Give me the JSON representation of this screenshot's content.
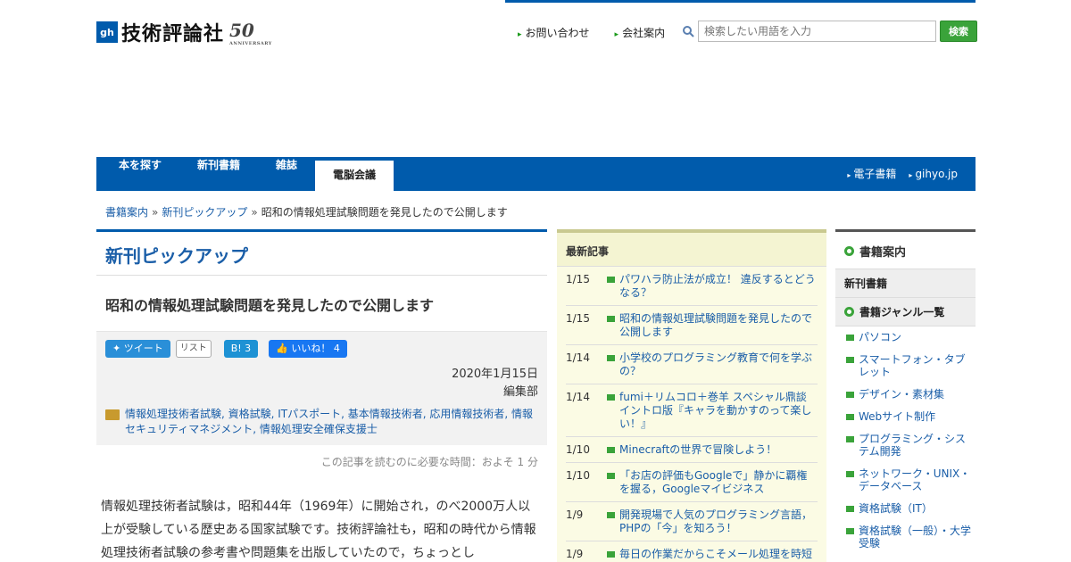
{
  "header": {
    "logo_mark": "gh",
    "logo_text": "技術評論社",
    "logo_anniv": "50",
    "logo_anniv_sub": "ANNIVERSARY",
    "links": [
      "お問い合わせ",
      "会社案内"
    ],
    "search_placeholder": "検索したい用語を入力",
    "search_button": "検索"
  },
  "nav": {
    "items": [
      "本を探す",
      "新刊書籍",
      "雑誌",
      "電脳会議"
    ],
    "right": [
      "電子書籍",
      "gihyo.jp"
    ]
  },
  "breadcrumb": [
    "書籍案内",
    "新刊ピックアップ",
    "昭和の情報処理試験問題を発見したので公開します"
  ],
  "main": {
    "section_title": "新刊ピックアップ",
    "article_title": "昭和の情報処理試験問題を発見したので公開します",
    "social": {
      "tweet": "ツイート",
      "list": "リスト",
      "hatena": "B! 3",
      "like": "いいね！ 4"
    },
    "date": "2020年1月15日",
    "author": "編集部",
    "tags": "情報処理技術者試験, 資格試験, ITパスポート, 基本情報技術者, 応用情報技術者, 情報セキュリティマネジメント, 情報処理安全確保支援士",
    "read_time": "この記事を読むのに必要な時間：およそ 1 分",
    "body": "情報処理技術者試験は，昭和44年（1969年）に開始され，のべ2000万人以上が受験している歴史ある国家試験です。技術評論社も，昭和の時代から情報処理技術者試験の参考書や問題集を出版していたので，ちょっとし"
  },
  "latest": {
    "heading": "最新記事",
    "items": [
      {
        "date": "1/15",
        "title": "パワハラ防止法が成立！ 違反するとどうなる？"
      },
      {
        "date": "1/15",
        "title": "昭和の情報処理試験問題を発見したので公開します"
      },
      {
        "date": "1/14",
        "title": "小学校のプログラミング教育で何を学ぶの？"
      },
      {
        "date": "1/14",
        "title": "fumi＋リムコロ＋巻羊 スペシャル鼎談 イントロ版『キャラを動かすのって楽しい！』"
      },
      {
        "date": "1/10",
        "title": "Minecraftの世界で冒険しよう！"
      },
      {
        "date": "1/10",
        "title": "「お店の評価もGoogleで」静かに覇権を握る，Googleマイビジネス"
      },
      {
        "date": "1/9",
        "title": "開発現場で人気のプログラミング言語，PHPの「今」を知ろう！"
      },
      {
        "date": "1/9",
        "title": "毎日の作業だからこそメール処理を時短"
      }
    ]
  },
  "side": {
    "heading": "書籍案内",
    "sub1": "新刊書籍",
    "sub2": "書籍ジャンル一覧",
    "items": [
      "パソコン",
      "スマートフォン・タブレット",
      "デザイン・素材集",
      "Webサイト制作",
      "プログラミング・システム開発",
      "ネットワーク・UNIX・データベース",
      "資格試験（IT）",
      "資格試験（一般）・大学受験"
    ]
  }
}
